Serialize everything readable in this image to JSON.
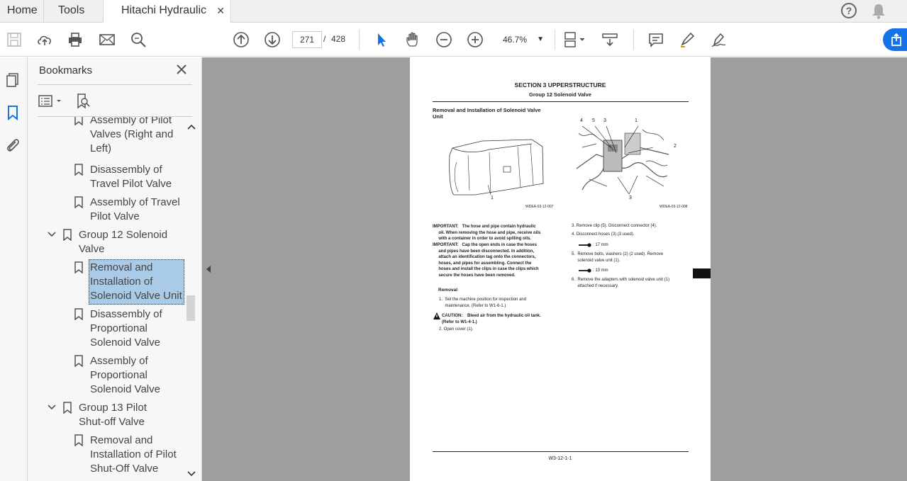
{
  "tabs": {
    "home": "Home",
    "tools": "Tools",
    "document": "Hitachi Hydraulic Ex...",
    "close": "✕"
  },
  "toolbar": {
    "current_page": "271",
    "separator": "/",
    "total_pages": "428",
    "zoom": "46.7%"
  },
  "bookmarks": {
    "title": "Bookmarks",
    "items": [
      {
        "text": "Assembly of Pilot\nValves (Right and\nLeft)"
      },
      {
        "text": "Disassembly of\nTravel Pilot Valve"
      },
      {
        "text": "Assembly of Travel\nPilot Valve"
      },
      {
        "text": "Group 12 Solenoid\nValve"
      },
      {
        "text": "Removal and\nInstallation of\nSolenoid Valve Unit"
      },
      {
        "text": "Disassembly of\nProportional\nSolenoid Valve"
      },
      {
        "text": "Assembly of\nProportional\nSolenoid Valve"
      },
      {
        "text": "Group 13 Pilot\nShut-off Valve"
      },
      {
        "text": "Removal and\nInstallation of Pilot\nShut-Off Valve"
      }
    ]
  },
  "page": {
    "section": "SECTION 3 UPPERSTRUCTURE",
    "group": "Group 12 Solenoid Valve",
    "heading": "Removal and Installation of Solenoid Valve\nUnit",
    "fig1_code": "WDEA-03-12-007",
    "fig2_code": "WDEA-03-12-008",
    "fig1_callout": "1",
    "fig2_callouts": [
      "4",
      "5",
      "3",
      "1",
      "2",
      "3"
    ],
    "important1": "IMPORTANT:   The hose and pipe contain hydraulic\n     oil. When removing the hose and pipe, receive oils\n     with a container in order to avoid spilling oils.",
    "important2": "IMPORTANT:   Cap the open ends in case the hoses\n     and pipes have been disconnected. In addition,\n     attach an identification tag onto the connectors,\n     hoses, and pipes for assembling. Connect the\n     hoses and install the clips in case the clips which\n     secure the hoses have been removed.",
    "removal_title": "Removal",
    "step1": "1.  Set the machine position for inspection and\n     maintenance. (Refer to W1-6-1.)",
    "caution": "CAUTION:    Bleed air from the hydraulic oil tank.\n(Refer to W1-4-1.)",
    "step2": "2.  Open cover (1).",
    "step3": "3.  Remove clip (5). Disconnect connector (4).",
    "step4": "4.  Disconnect hoses (3) (3 used).",
    "wrench1": ": 17 mm",
    "step5": "5.  Remove bolts, washers (2) (2 used). Remove\n     solenoid valve unit (1).",
    "wrench2": ": 13 mm",
    "step6": "6.  Remove the adapters with solenoid valve unit (1)\n     attached if necessary.",
    "footer": "W3-12-1-1"
  }
}
